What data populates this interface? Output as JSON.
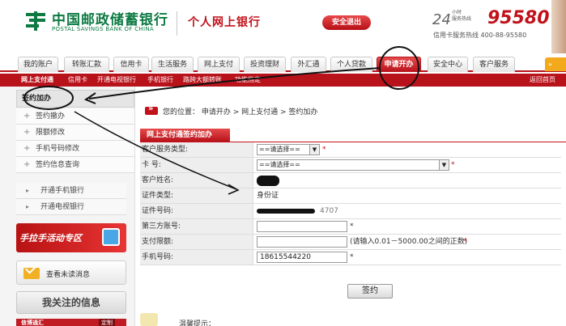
{
  "header": {
    "logo_cn": "中国邮政储蓄银行",
    "logo_en": "POSTAL SAVINGS BANK OF CHINA",
    "brand_title": "个人网上银行",
    "logout_label": "安全退出",
    "hotline_24": "24",
    "hotline_small_1": "小时",
    "hotline_small_2": "服务热线",
    "hotline_number": "95580",
    "card_hotline": "信用卡服务热线 400-88-95580"
  },
  "main_nav": {
    "tabs": [
      {
        "label": "我的账户"
      },
      {
        "label": "转账汇款"
      },
      {
        "label": "信用卡"
      },
      {
        "label": "生活服务"
      },
      {
        "label": "网上支付"
      },
      {
        "label": "投资理财"
      },
      {
        "label": "外汇通"
      },
      {
        "label": "个人贷款"
      },
      {
        "label": "申请开办"
      },
      {
        "label": "安全中心"
      },
      {
        "label": "客户服务"
      }
    ],
    "more_label": "»"
  },
  "sub_nav": {
    "items": [
      {
        "label": "网上支付通"
      },
      {
        "label": "信用卡"
      },
      {
        "label": "开通电视银行"
      },
      {
        "label": "手机银行"
      },
      {
        "label": "路跨大额转账"
      },
      {
        "label": "功能指定"
      }
    ],
    "back_home": "返回首页"
  },
  "sidebar": {
    "title": "签约加办",
    "items": [
      {
        "label": "签约撤办"
      },
      {
        "label": "限额修改"
      },
      {
        "label": "手机号码修改"
      },
      {
        "label": "签约信息查询"
      }
    ],
    "extra_items": [
      {
        "label": "开通手机银行"
      },
      {
        "label": "开通电视银行"
      }
    ],
    "promo_label": "手拉手活动专区",
    "unread_label": "查看未读消息",
    "follow_label": "我关注的信息",
    "card_strip_label": "信博通汇",
    "card_strip_badge": "定制"
  },
  "content": {
    "breadcrumb": "您的位置：  申请开办 > 网上支付通 > 签约加办",
    "panel_title": "网上支付通签约加办",
    "form": {
      "customer_type_label": "客户服务类型:",
      "customer_type_value": "==请选择==",
      "card_label": "卡  号:",
      "card_value": "==请选择==",
      "name_label": "客户姓名:",
      "id_type_label": "证件类型:",
      "id_type_value": "身份证",
      "id_number_label": "证件号码:",
      "id_number_tail": "4707",
      "third_party_label": "第三方账号:",
      "third_party_value": "",
      "limit_label": "支付限额:",
      "limit_value": "",
      "limit_hint": "(请输入0.01－5000.00之间的正数)",
      "phone_label": "手机号码:",
      "phone_value": "18615544220",
      "required_mark": "*"
    },
    "submit_label": "签约",
    "tips_label": "温馨提示："
  },
  "colors": {
    "brand_red": "#b8121b",
    "brand_green": "#0d7a43",
    "accent_orange": "#f2a91c"
  }
}
